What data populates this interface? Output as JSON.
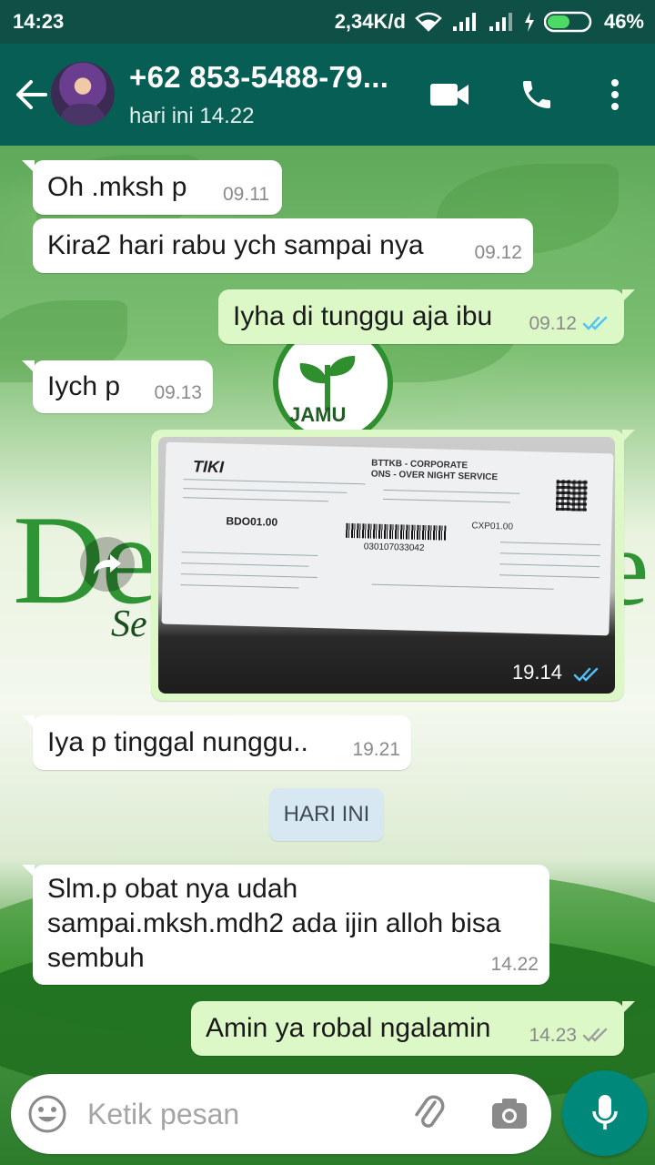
{
  "status_bar": {
    "time": "14:23",
    "network_speed": "2,34K/d",
    "battery": "46%"
  },
  "header": {
    "contact_name": "+62 853-5488-79...",
    "last_seen": "hari ini 14.22"
  },
  "background_text": {
    "jamu": "JAMU",
    "brand_left": "De",
    "brand_right": "e",
    "tagline": "Se"
  },
  "messages": [
    {
      "direction": "in",
      "text": "Oh .mksh p",
      "time": "09.11"
    },
    {
      "direction": "in",
      "text": "Kira2 hari rabu ych sampai nya",
      "time": "09.12"
    },
    {
      "direction": "out",
      "text": "Iyha di tunggu aja ibu",
      "time": "09.12",
      "status": "read"
    },
    {
      "direction": "in",
      "text": "Iych p",
      "time": "09.13"
    },
    {
      "direction": "out",
      "type": "image",
      "time": "19.14",
      "status": "read"
    },
    {
      "direction": "in",
      "text": "Iya p tinggal nunggu..",
      "time": "19.21"
    },
    {
      "direction": "in",
      "text_lines": [
        "Slm.p obat nya udah",
        "sampai.mksh.mdh2 ada ijin alloh bisa",
        "sembuh"
      ],
      "time": "14.22"
    },
    {
      "direction": "out",
      "text": "Amin ya robal ngalamin",
      "time": "14.23",
      "status": "delivered"
    }
  ],
  "receipt": {
    "logo": "TIKI",
    "company": "BTTKB - CORPORATE",
    "service": "ONS - OVER NIGHT SERVICE",
    "code": "BDO01.00",
    "dest": "CXP01.00",
    "barcode_number": "030107033042"
  },
  "day_divider": "HARI INI",
  "composer": {
    "placeholder": "Ketik pesan"
  },
  "colors": {
    "header": "#075e54",
    "status_bar": "#0e4f46",
    "outgoing_bubble": "#dcf8c6",
    "incoming_bubble": "#ffffff",
    "read_ticks": "#4fc3f7",
    "mic_button": "#00897b"
  }
}
